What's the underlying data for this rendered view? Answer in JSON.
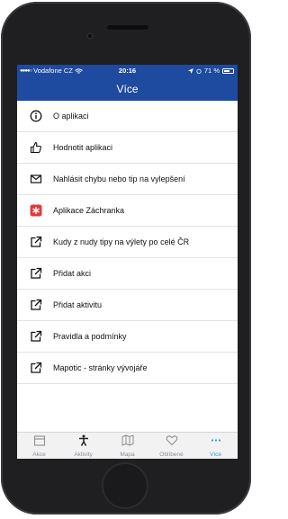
{
  "status": {
    "carrier": "Vodafone CZ",
    "time": "20:16",
    "battery": "71 %",
    "battery_level": 0.71
  },
  "nav": {
    "title": "Více"
  },
  "menu": [
    {
      "label": "O aplikaci",
      "icon": "info-icon"
    },
    {
      "label": "Hodnotit aplikaci",
      "icon": "thumbs-up-icon"
    },
    {
      "label": "Nahlásit chybu nebo tip na vylepšení",
      "icon": "mail-icon"
    },
    {
      "label": "Aplikace Záchranka",
      "icon": "zachranka-app-icon"
    },
    {
      "label": "Kudy z nudy tipy na výlety po celé ČR",
      "icon": "external-link-icon"
    },
    {
      "label": "Přidat akci",
      "icon": "external-link-icon"
    },
    {
      "label": "Přidat aktivitu",
      "icon": "external-link-icon"
    },
    {
      "label": "Pravidla a podmínky",
      "icon": "external-link-icon"
    },
    {
      "label": "Mapotic - stránky vývojáře",
      "icon": "external-link-icon"
    }
  ],
  "tabs": [
    {
      "label": "Akce",
      "icon": "calendar-icon"
    },
    {
      "label": "Aktivity",
      "icon": "person-activity-icon"
    },
    {
      "label": "Mapa",
      "icon": "map-icon"
    },
    {
      "label": "Oblíbené",
      "icon": "heart-icon"
    },
    {
      "label": "Více",
      "icon": "more-icon",
      "active": true
    }
  ],
  "colors": {
    "brand": "#1e4aa0",
    "active_tab": "#2d9cdb",
    "zachranka_red": "#e03a3a"
  }
}
